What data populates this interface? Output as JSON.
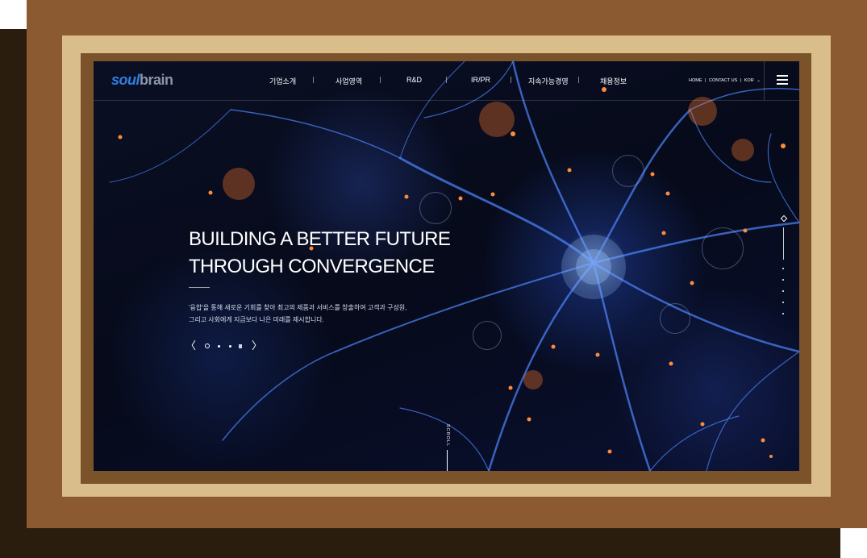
{
  "logo": {
    "part1": "soul",
    "part2": "brain"
  },
  "nav": {
    "items": [
      {
        "label": "기업소개"
      },
      {
        "label": "사업영역"
      },
      {
        "label": "R&D"
      },
      {
        "label": "IR/PR"
      },
      {
        "label": "지속가능경영"
      },
      {
        "label": "채용정보"
      }
    ]
  },
  "util": {
    "home": "HOME",
    "sep": "|",
    "contact": "CONTACT US",
    "lang": "KOR",
    "lang_arrow": "⌄"
  },
  "hero": {
    "title_line1": "BUILDING A BETTER FUTURE",
    "title_line2": "THROUGH CONVERGENCE",
    "desc_line1": "'융합'을 통해 새로운 기회를 찾아 최고의 제품과 서비스를 창출하여 고객과 구성원,",
    "desc_line2": "그리고 사회에게 지금보다 나은 미래를 제시합니다.",
    "prev": "〈",
    "next": "〉"
  },
  "scroll": {
    "label": "SCROLL"
  },
  "colors": {
    "frame_outer": "#8b5a30",
    "frame_shadow": "#2b1d0e",
    "mat": "#d9bd8a",
    "logo_soul": "#2f7fe0",
    "logo_brain": "#8a96a6",
    "screen_bg": "#060a1a"
  }
}
